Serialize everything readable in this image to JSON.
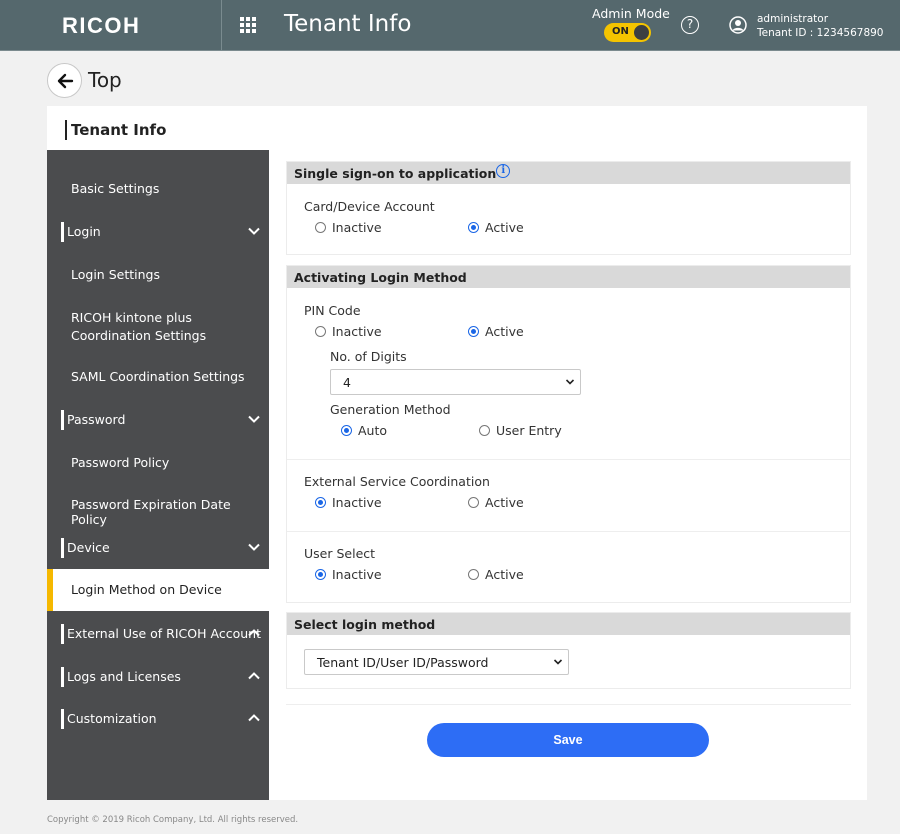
{
  "header": {
    "logo": "RICOH",
    "app_title": "Tenant Info",
    "admin_mode_label": "Admin Mode",
    "admin_toggle": "ON",
    "user_name": "administrator",
    "tenant_id": "Tenant ID : 1234567890",
    "accent_color": "#f5c400"
  },
  "nav": {
    "back_label": "Top"
  },
  "panel": {
    "title": "Tenant Info"
  },
  "sidebar": {
    "items": [
      {
        "label": "Basic Settings",
        "type": "sub"
      },
      {
        "label": "Login",
        "type": "group",
        "chevron": "down"
      },
      {
        "label": "Login Settings",
        "type": "sub"
      },
      {
        "label": "RICOH kintone plus Coordination Settings",
        "type": "sub"
      },
      {
        "label": "SAML Coordination Settings",
        "type": "sub"
      },
      {
        "label": "Password",
        "type": "group",
        "chevron": "down"
      },
      {
        "label": "Password Policy",
        "type": "sub"
      },
      {
        "label": "Password Expiration Date Policy",
        "type": "sub"
      },
      {
        "label": "Device",
        "type": "group",
        "chevron": "down"
      },
      {
        "label": "Login Method on Device",
        "type": "sub",
        "active": true
      },
      {
        "label": "External Use of RICOH Account",
        "type": "group",
        "chevron": "up"
      },
      {
        "label": "Logs and Licenses",
        "type": "group",
        "chevron": "up"
      },
      {
        "label": "Customization",
        "type": "group",
        "chevron": "up"
      }
    ]
  },
  "sso": {
    "header": "Single sign-on to application",
    "card_device_account": {
      "label": "Card/Device Account",
      "options": [
        "Inactive",
        "Active"
      ],
      "selected": "Active"
    }
  },
  "activating": {
    "header": "Activating Login Method",
    "pin_code": {
      "label": "PIN Code",
      "options": [
        "Inactive",
        "Active"
      ],
      "selected": "Active",
      "digits_label": "No. of Digits",
      "digits_value": "4",
      "generation_label": "Generation Method",
      "generation_options": [
        "Auto",
        "User Entry"
      ],
      "generation_selected": "Auto"
    },
    "external_service": {
      "label": "External Service Coordination",
      "options": [
        "Inactive",
        "Active"
      ],
      "selected": "Inactive"
    },
    "user_select": {
      "label": "User Select",
      "options": [
        "Inactive",
        "Active"
      ],
      "selected": "Inactive"
    }
  },
  "select_login": {
    "header": "Select login method",
    "value": "Tenant ID/User ID/Password"
  },
  "actions": {
    "save_label": "Save",
    "save_color": "#2d6df5"
  },
  "footer": {
    "copyright": "Copyright © 2019 Ricoh Company, Ltd. All rights reserved."
  }
}
